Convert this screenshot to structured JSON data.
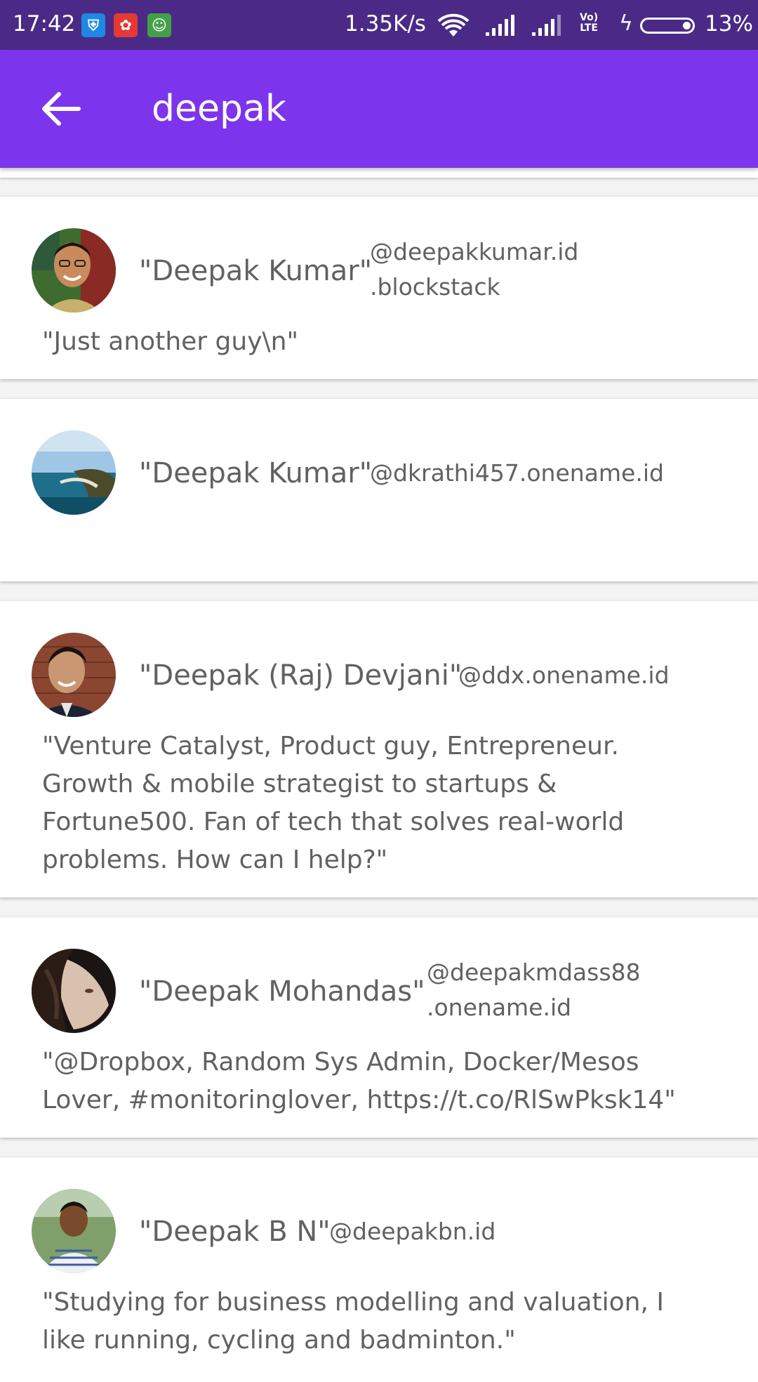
{
  "status_bar": {
    "time": "17:42",
    "network_speed": "1.35K/s",
    "volte_line1": "Vo)",
    "volte_line2": "LTE",
    "battery_percent": "13%",
    "app_icons": [
      "shield-app-icon",
      "huawei-app-icon",
      "android-app-icon"
    ],
    "icon_colors": [
      "#1e88e5",
      "#e53935",
      "#43a047"
    ]
  },
  "toolbar": {
    "title": "deepak",
    "back_icon": "arrow-back-icon",
    "background": "#7c34ec"
  },
  "results": [
    {
      "name": "\"Deepak Kumar\"",
      "handle_line1": "@deepakkumar.id",
      "handle_line2": ".blockstack",
      "bio": "\"Just another guy\\n\""
    },
    {
      "name": "\"Deepak Kumar\"",
      "handle_line1": "@dkrathi457.onename.id",
      "handle_line2": "",
      "bio": ""
    },
    {
      "name": "\"Deepak (Raj) Devjani\"",
      "handle_line1": "@ddx.onename.id",
      "handle_line2": "",
      "bio": "\"Venture Catalyst, Product guy, Entrepreneur.\nGrowth & mobile strategist to startups &\nFortune500. Fan of tech that solves real-world\nproblems. How can I help?\""
    },
    {
      "name": "\"Deepak Mohandas\"",
      "handle_line1": "@deepakmdass88",
      "handle_line2": ".onename.id",
      "bio": "\"@Dropbox, Random Sys Admin, Docker/Mesos\nLover, #monitoringlover, https://t.co/RlSwPksk14\""
    },
    {
      "name": "\"Deepak B N\"",
      "handle_line1": "@deepakbn.id",
      "handle_line2": "",
      "bio": "\"Studying for business modelling and valuation, I\nlike running, cycling and badminton.\""
    }
  ]
}
